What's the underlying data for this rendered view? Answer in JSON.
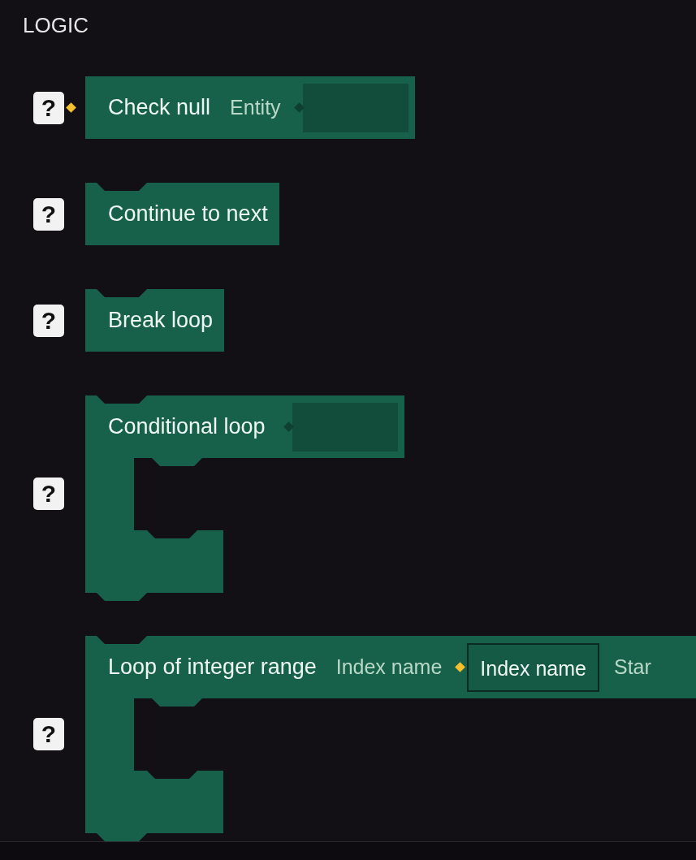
{
  "section_title": "LOGIC",
  "blocks": [
    {
      "kind": "value",
      "help": "?",
      "title": "Check null",
      "inputs": [
        {
          "kind": "label",
          "text": "Entity"
        },
        {
          "kind": "slot",
          "connected": false
        }
      ]
    },
    {
      "kind": "statement",
      "help": "?",
      "title": "Continue to next"
    },
    {
      "kind": "statement",
      "help": "?",
      "title": "Break loop"
    },
    {
      "kind": "loop",
      "help": "?",
      "title": "Conditional loop",
      "inputs": [
        {
          "kind": "slot",
          "connected": false
        }
      ]
    },
    {
      "kind": "loop",
      "help": "?",
      "title": "Loop of integer range",
      "inputs": [
        {
          "kind": "label",
          "text": "Index name"
        },
        {
          "kind": "field",
          "connected": true,
          "value": "Index name"
        },
        {
          "kind": "label",
          "text": "Star"
        }
      ]
    }
  ]
}
